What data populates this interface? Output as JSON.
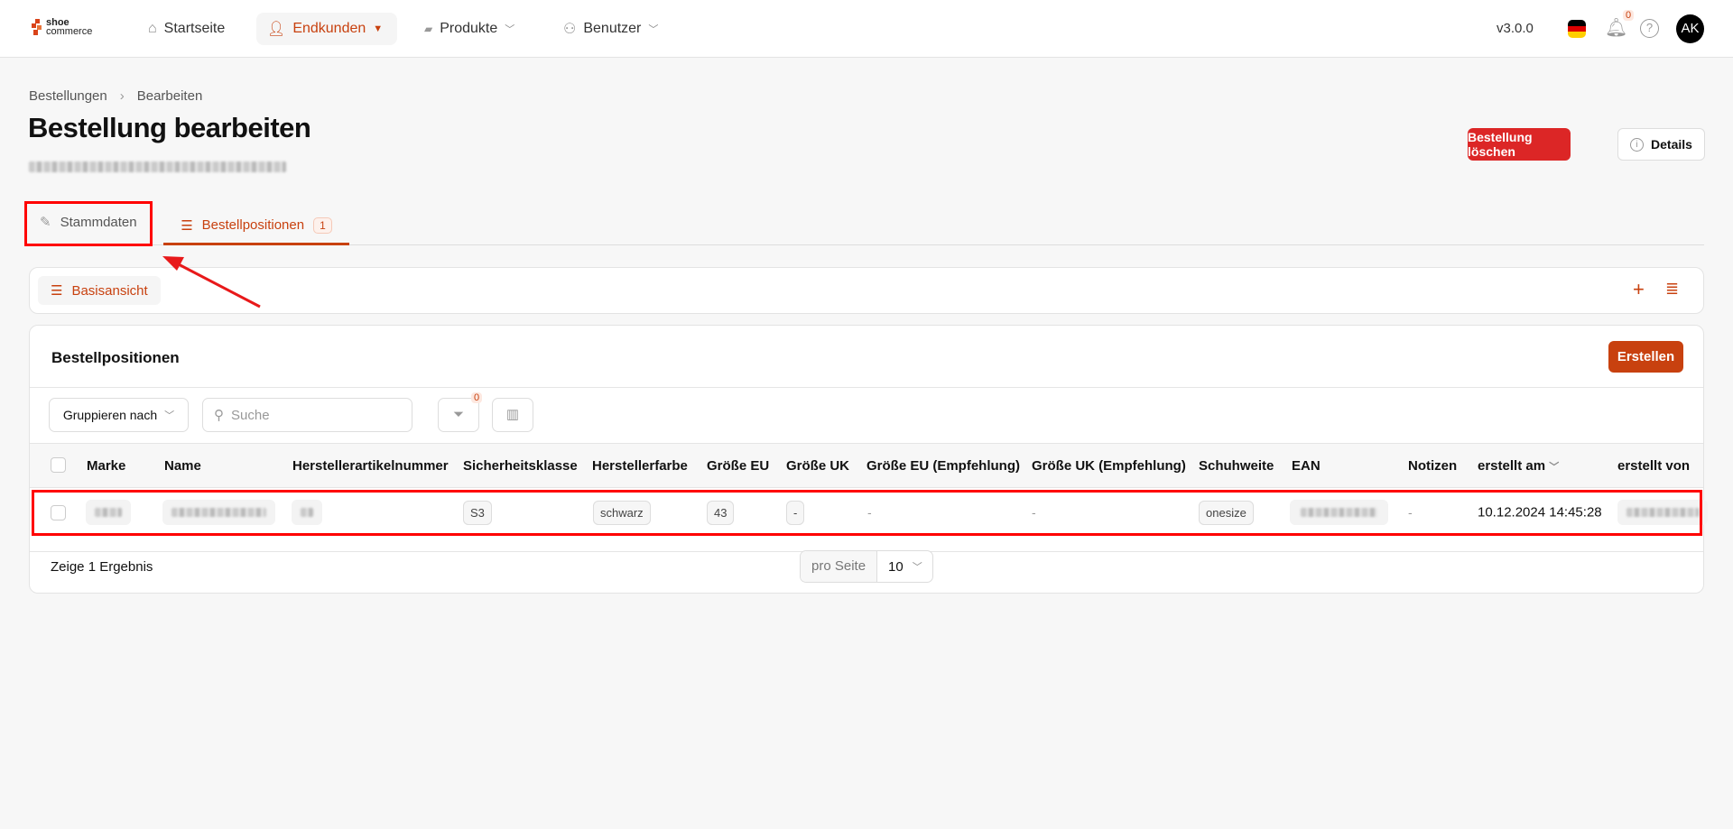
{
  "header": {
    "logo_text_top": "shoe",
    "logo_text_bottom": "commerce",
    "nav": [
      {
        "label": "Startseite"
      },
      {
        "label": "Endkunden"
      },
      {
        "label": "Produkte"
      },
      {
        "label": "Benutzer"
      }
    ],
    "version": "v3.0.0",
    "notification_count": "0",
    "avatar_initials": "AK"
  },
  "breadcrumb": {
    "items": [
      "Bestellungen",
      "Bearbeiten"
    ]
  },
  "page": {
    "title": "Bestellung bearbeiten",
    "delete_button": "Bestellung löschen",
    "details_button": "Details"
  },
  "tabs": [
    {
      "label": "Stammdaten"
    },
    {
      "label": "Bestellpositionen",
      "count": "1"
    }
  ],
  "view": {
    "label": "Basisansicht"
  },
  "table_card": {
    "title": "Bestellpositionen",
    "create_button": "Erstellen",
    "group_by": "Gruppieren nach",
    "search_placeholder": "Suche",
    "filter_count": "0",
    "columns": [
      "Marke",
      "Name",
      "Herstellerartikelnummer",
      "Sicherheitsklasse",
      "Herstellerfarbe",
      "Größe EU",
      "Größe UK",
      "Größe EU (Empfehlung)",
      "Größe UK (Empfehlung)",
      "Schuhweite",
      "EAN",
      "Notizen",
      "erstellt am",
      "erstellt von"
    ],
    "rows": [
      {
        "sicherheitsklasse": "S3",
        "herstellerfarbe": "schwarz",
        "groesse_eu": "43",
        "groesse_uk": "-",
        "groesse_eu_empf": "-",
        "groesse_uk_empf": "-",
        "schuhweite": "onesize",
        "notizen": "-",
        "erstellt_am": "10.12.2024 14:45:28"
      }
    ],
    "result_text": "Zeige 1 Ergebnis",
    "per_page_label": "pro Seite",
    "per_page_value": "10"
  },
  "colors": {
    "accent": "#c8410f",
    "danger": "#dc2626",
    "annotation": "#ff0000"
  }
}
